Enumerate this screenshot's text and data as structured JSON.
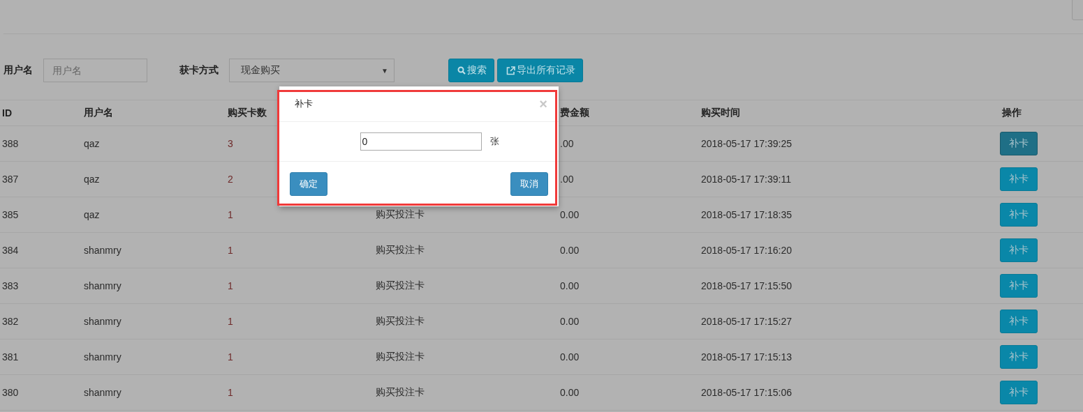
{
  "filters": [
    {
      "label": "用户名",
      "kind": "input",
      "placeholder": "用户名"
    },
    {
      "label": "获卡方式",
      "kind": "select",
      "value": "现金购买",
      "caret": "▼"
    }
  ],
  "actions": [
    {
      "label": "搜索",
      "kind": "search"
    },
    {
      "label": "导出所有记录",
      "kind": "export"
    }
  ],
  "table": {
    "columns": [
      "ID",
      "用户名",
      "购买卡数",
      "",
      "费金额",
      "购买时间",
      "操作"
    ],
    "rows": [
      {
        "cells": [
          "388",
          "qaz",
          "3",
          "",
          ".00",
          "2018-05-17 17:39:25"
        ],
        "action": "补卡",
        "active": true
      },
      {
        "cells": [
          "387",
          "qaz",
          "2",
          "",
          ".00",
          "2018-05-17 17:39:11"
        ],
        "action": "补卡",
        "active": false
      },
      {
        "cells": [
          "385",
          "qaz",
          "1",
          "购买投注卡",
          "0.00",
          "2018-05-17 17:18:35"
        ],
        "action": "补卡",
        "active": false
      },
      {
        "cells": [
          "384",
          "shanmry",
          "1",
          "购买投注卡",
          "0.00",
          "2018-05-17 17:16:20"
        ],
        "action": "补卡",
        "active": false
      },
      {
        "cells": [
          "383",
          "shanmry",
          "1",
          "购买投注卡",
          "0.00",
          "2018-05-17 17:15:50"
        ],
        "action": "补卡",
        "active": false
      },
      {
        "cells": [
          "382",
          "shanmry",
          "1",
          "购买投注卡",
          "0.00",
          "2018-05-17 17:15:27"
        ],
        "action": "补卡",
        "active": false
      },
      {
        "cells": [
          "381",
          "shanmry",
          "1",
          "购买投注卡",
          "0.00",
          "2018-05-17 17:15:13"
        ],
        "action": "补卡",
        "active": false
      },
      {
        "cells": [
          "380",
          "shanmry",
          "1",
          "购买投注卡",
          "0.00",
          "2018-05-17 17:15:06"
        ],
        "action": "补卡",
        "active": false
      }
    ]
  },
  "dialog": {
    "title": "补卡",
    "close": "×",
    "value": "0",
    "unit": "张",
    "confirm": "确定",
    "cancel": "取消"
  }
}
